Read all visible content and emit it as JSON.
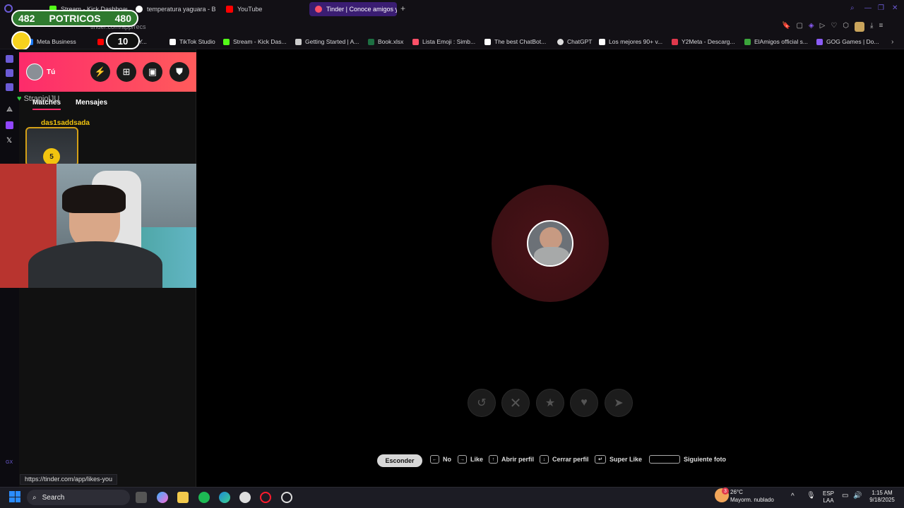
{
  "browser": {
    "tabs": [
      {
        "label": "Stream - Kick Dashboard",
        "color": "#53fc18"
      },
      {
        "label": "temperatura yaguara - Bu",
        "color": "#ffffff"
      },
      {
        "label": "YouTube",
        "color": "#ff0000"
      },
      {
        "label": "Tinder | Conoce amigos y",
        "color": "#fd5068",
        "active": true
      }
    ],
    "address": "tinder.com/app/recs",
    "bookmarks": [
      {
        "label": "Meta Business",
        "color": "#1877f2"
      },
      {
        "label": "Caba...ño - Y...",
        "color": "#ff0000"
      },
      {
        "label": "TikTok Studio",
        "color": "#ffffff"
      },
      {
        "label": "Stream - Kick Das...",
        "color": "#53fc18"
      },
      {
        "label": "Getting Started | A...",
        "color": "#cccccc"
      },
      {
        "label": "Book.xlsx",
        "color": "#1d6f42"
      },
      {
        "label": "Lista Emoji : Simb...",
        "color": "#fd5068"
      },
      {
        "label": "The best ChatBot...",
        "color": "#ffffff"
      },
      {
        "label": "ChatGPT",
        "color": "#dddddd"
      },
      {
        "label": "Los mejores 90+ v...",
        "color": "#ffffff"
      },
      {
        "label": "Y2Meta - Descarg...",
        "color": "#e0384c"
      },
      {
        "label": "ElAmigos official s...",
        "color": "#3ba53b"
      },
      {
        "label": "GOG Games | Do...",
        "color": "#8b5cf6"
      }
    ]
  },
  "overlay": {
    "counter_left": "482",
    "counter_label": "POTRICOS",
    "counter_right": "480",
    "small_count": "10",
    "streamer_tag": "StrapiolJU"
  },
  "tinder": {
    "user_label": "Tú",
    "tab_matches": "Matches",
    "tab_messages": "Mensajes",
    "match_name": "das1saddsada",
    "likes_count": "5",
    "actions": [
      "undo",
      "nope",
      "superlike",
      "like",
      "boost"
    ],
    "shortcuts": {
      "hide": "Esconder",
      "no": "No",
      "like": "Like",
      "open_profile": "Abrir perfil",
      "close_profile": "Cerrar perfil",
      "super_like": "Super Like",
      "next_photo": "Siguiente foto"
    },
    "status_link": "https://tinder.com/app/likes-you"
  },
  "taskbar": {
    "search_placeholder": "Search",
    "weather_temp": "26°C",
    "weather_desc": "Mayorm. nublado",
    "weather_badge": "3",
    "lang_1": "ESP",
    "lang_2": "LAA",
    "time": "1:15 AM",
    "date": "9/18/2025"
  },
  "colors": {
    "tinder_gradient_start": "#fd2b6b",
    "tinder_gradient_end": "#ff5b5b",
    "opera_accent": "#6b5bd6",
    "counter_green": "#2f7a2f"
  }
}
